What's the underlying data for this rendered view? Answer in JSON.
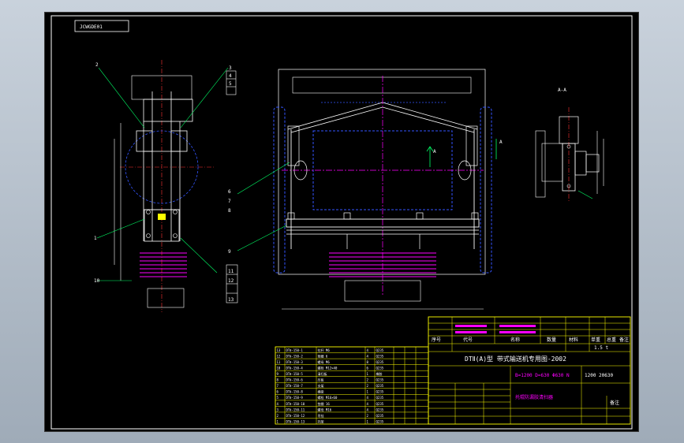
{
  "sheet_code": "JCWGDE01",
  "section_label": "A-A",
  "section_mark": "A",
  "part_numbers": [
    "2",
    "3",
    "4",
    "5",
    "1",
    "6",
    "7",
    "8",
    "9",
    "10",
    "11",
    "12",
    "13"
  ],
  "title_block": {
    "drawing_title": "DTⅡ(A)型 带式输送机专用图-2002",
    "spec_line": "B=1200 D=630 Φ630 N",
    "drawing_no": "1200 20630",
    "mass": "1.5 t",
    "part_name": "托辊防漏胶清扫器",
    "header_cells": [
      "序号",
      "代号",
      "名称",
      "数量",
      "材料",
      "单重",
      "总重",
      "备注"
    ],
    "remark": "备注"
  },
  "bom_rows": [
    [
      "13",
      "DTⅡ-150-1",
      "拉杆 M6",
      "4",
      "Q235",
      "",
      "",
      ""
    ],
    [
      "12",
      "DTⅡ-150-2",
      "垫圈 6",
      "4",
      "Q235",
      "",
      "",
      ""
    ],
    [
      "11",
      "DTⅡ-150-3",
      "螺母 M6",
      "8",
      "Q235",
      "",
      "",
      ""
    ],
    [
      "10",
      "DTⅡ-150-4",
      "螺栓 M12×40",
      "6",
      "Q235",
      "",
      "",
      ""
    ],
    [
      "9",
      "DTⅡ-150-5",
      "清扫板",
      "1",
      "橡胶",
      "",
      "",
      ""
    ],
    [
      "8",
      "DTⅡ-150-6",
      "压板",
      "2",
      "Q235",
      "",
      "",
      ""
    ],
    [
      "7",
      "DTⅡ-150-7",
      "支架",
      "2",
      "Q235",
      "",
      "",
      ""
    ],
    [
      "6",
      "DTⅡ-150-8",
      "横梁",
      "1",
      "Q235",
      "",
      "",
      ""
    ],
    [
      "5",
      "DTⅡ-150-9",
      "螺栓 M16×60",
      "4",
      "Q235",
      "",
      "",
      ""
    ],
    [
      "4",
      "DTⅡ-150-10",
      "垫圈 16",
      "4",
      "Q235",
      "",
      "",
      ""
    ],
    [
      "3",
      "DTⅡ-150-11",
      "螺母 M16",
      "4",
      "Q235",
      "",
      "",
      ""
    ],
    [
      "2",
      "DTⅡ-150-12",
      "吊挂",
      "2",
      "Q235",
      "",
      "",
      ""
    ],
    [
      "1",
      "DTⅡ-150-13",
      "托架",
      "1",
      "Q235",
      "",
      "",
      ""
    ]
  ]
}
